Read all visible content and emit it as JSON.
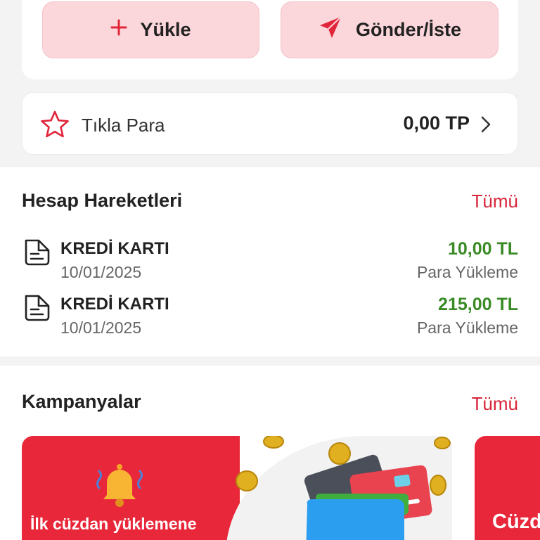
{
  "actions": {
    "load_label": "Yükle",
    "send_label": "Gönder/İste"
  },
  "tikla_para": {
    "label": "Tıkla Para",
    "value": "0,00 TP"
  },
  "account_activity": {
    "title": "Hesap Hareketleri",
    "see_all": "Tümü",
    "transactions": [
      {
        "name": "KREDİ KARTI",
        "date": "10/01/2025",
        "amount": "10,00 TL",
        "type": "Para Yükleme"
      },
      {
        "name": "KREDİ KARTI",
        "date": "10/01/2025",
        "amount": "215,00 TL",
        "type": "Para Yükleme"
      }
    ]
  },
  "campaigns": {
    "title": "Kampanyalar",
    "see_all": "Tümü",
    "banners": [
      {
        "text": "İlk cüzdan yüklemene"
      },
      {
        "text": "Cüzd"
      }
    ]
  },
  "colors": {
    "accent": "#d8263a",
    "button_bg": "#fbd6da",
    "positive_amount": "#3a8a26"
  }
}
